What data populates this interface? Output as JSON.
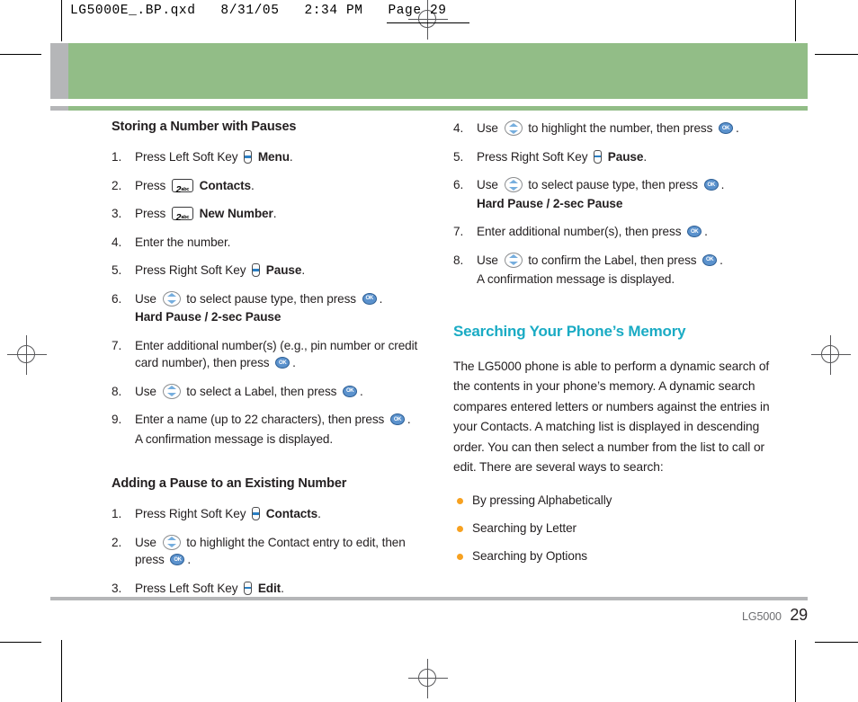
{
  "print_slug": {
    "text": "LG5000E_.BP.qxd   8/31/05   2:34 PM   Page 29"
  },
  "left_column": {
    "section_1": {
      "heading": "Storing a Number with Pauses",
      "steps": [
        {
          "num": "1.",
          "parts": [
            {
              "t": "text",
              "v": "Press Left Soft Key "
            },
            {
              "t": "icon",
              "v": "soft-key-icon"
            },
            {
              "t": "bold",
              "v": " Menu"
            },
            {
              "t": "text",
              "v": "."
            }
          ]
        },
        {
          "num": "2.",
          "parts": [
            {
              "t": "text",
              "v": "Press "
            },
            {
              "t": "numkey",
              "v": "2",
              "sub": "abc"
            },
            {
              "t": "bold",
              "v": " Contacts"
            },
            {
              "t": "text",
              "v": "."
            }
          ]
        },
        {
          "num": "3.",
          "parts": [
            {
              "t": "text",
              "v": "Press "
            },
            {
              "t": "numkey",
              "v": "2",
              "sub": "abc"
            },
            {
              "t": "bold",
              "v": " New Number"
            },
            {
              "t": "text",
              "v": "."
            }
          ]
        },
        {
          "num": "4.",
          "parts": [
            {
              "t": "text",
              "v": "Enter the number."
            }
          ]
        },
        {
          "num": "5.",
          "parts": [
            {
              "t": "text",
              "v": "Press Right Soft Key "
            },
            {
              "t": "icon",
              "v": "soft-key-icon"
            },
            {
              "t": "bold",
              "v": " Pause"
            },
            {
              "t": "text",
              "v": "."
            }
          ]
        },
        {
          "num": "6.",
          "parts": [
            {
              "t": "text",
              "v": "Use "
            },
            {
              "t": "icon",
              "v": "nav-updown-icon"
            },
            {
              "t": "text",
              "v": " to select pause type, then press "
            },
            {
              "t": "icon",
              "v": "ok-key-icon"
            },
            {
              "t": "text",
              "v": "."
            }
          ],
          "sub_bold": "Hard Pause / 2-sec Pause"
        },
        {
          "num": "7.",
          "parts": [
            {
              "t": "text",
              "v": "Enter additional number(s) (e.g., pin number or credit card number), then press "
            },
            {
              "t": "icon",
              "v": "ok-key-icon"
            },
            {
              "t": "text",
              "v": "."
            }
          ]
        },
        {
          "num": "8.",
          "parts": [
            {
              "t": "text",
              "v": "Use "
            },
            {
              "t": "icon",
              "v": "nav-updown-icon"
            },
            {
              "t": "text",
              "v": " to select a Label, then press "
            },
            {
              "t": "icon",
              "v": "ok-key-icon"
            },
            {
              "t": "text",
              "v": "."
            }
          ]
        },
        {
          "num": "9.",
          "parts": [
            {
              "t": "text",
              "v": "Enter a name (up to 22 characters), then press "
            },
            {
              "t": "icon",
              "v": "ok-key-icon"
            },
            {
              "t": "text",
              "v": "."
            }
          ],
          "sub_plain": "A confirmation message is displayed."
        }
      ]
    },
    "section_2": {
      "heading": "Adding a Pause to an Existing Number",
      "steps": [
        {
          "num": "1.",
          "parts": [
            {
              "t": "text",
              "v": "Press Right Soft Key "
            },
            {
              "t": "icon",
              "v": "soft-key-icon"
            },
            {
              "t": "bold",
              "v": " Contacts"
            },
            {
              "t": "text",
              "v": "."
            }
          ]
        },
        {
          "num": "2.",
          "parts": [
            {
              "t": "text",
              "v": "Use "
            },
            {
              "t": "icon",
              "v": "nav-updown-icon"
            },
            {
              "t": "text",
              "v": " to highlight the Contact entry to edit, then press "
            },
            {
              "t": "icon",
              "v": "ok-key-icon"
            },
            {
              "t": "text",
              "v": "."
            }
          ]
        },
        {
          "num": "3.",
          "parts": [
            {
              "t": "text",
              "v": "Press Left Soft Key "
            },
            {
              "t": "icon",
              "v": "soft-key-icon"
            },
            {
              "t": "bold",
              "v": " Edit"
            },
            {
              "t": "text",
              "v": "."
            }
          ]
        }
      ]
    }
  },
  "right_column": {
    "continued_steps": [
      {
        "num": "4.",
        "parts": [
          {
            "t": "text",
            "v": "Use "
          },
          {
            "t": "icon",
            "v": "nav-updown-icon"
          },
          {
            "t": "text",
            "v": " to highlight the number, then press "
          },
          {
            "t": "icon",
            "v": "ok-key-icon"
          },
          {
            "t": "text",
            "v": "."
          }
        ]
      },
      {
        "num": "5.",
        "parts": [
          {
            "t": "text",
            "v": "Press Right Soft Key "
          },
          {
            "t": "icon",
            "v": "soft-key-icon"
          },
          {
            "t": "bold",
            "v": " Pause"
          },
          {
            "t": "text",
            "v": "."
          }
        ]
      },
      {
        "num": "6.",
        "parts": [
          {
            "t": "text",
            "v": "Use "
          },
          {
            "t": "icon",
            "v": "nav-updown-icon"
          },
          {
            "t": "text",
            "v": " to select pause type, then press "
          },
          {
            "t": "icon",
            "v": "ok-key-icon"
          },
          {
            "t": "text",
            "v": "."
          }
        ],
        "sub_bold": "Hard Pause / 2-sec Pause"
      },
      {
        "num": "7.",
        "parts": [
          {
            "t": "text",
            "v": "Enter additional number(s), then press "
          },
          {
            "t": "icon",
            "v": "ok-key-icon"
          },
          {
            "t": "text",
            "v": "."
          }
        ]
      },
      {
        "num": "8.",
        "parts": [
          {
            "t": "text",
            "v": "Use "
          },
          {
            "t": "icon",
            "v": "nav-updown-icon"
          },
          {
            "t": "text",
            "v": " to confirm the Label, then press "
          },
          {
            "t": "icon",
            "v": "ok-key-icon"
          },
          {
            "t": "text",
            "v": "."
          }
        ],
        "sub_plain": "A confirmation message is displayed."
      }
    ],
    "section": {
      "heading": "Searching Your Phone’s Memory",
      "paragraph": "The LG5000 phone is able to perform a dynamic search of the contents in your phone’s memory. A dynamic search compares entered letters or numbers against the entries in your Contacts. A matching list is displayed in descending order. You can then select a number from the list to call or edit. There are several ways to search:",
      "bullets": [
        "By pressing Alphabetically",
        "Searching by Letter",
        "Searching by Options"
      ]
    }
  },
  "footer": {
    "brand": "LG5000",
    "page_number": "29"
  },
  "colors": {
    "banner_green": "#92bd87",
    "banner_tab_gray": "#b5b6b8",
    "heading_teal": "#1aabc4",
    "bullet_orange": "#f7a120",
    "key_blue": "#5b92cd",
    "nav_arrow_blue": "#76aede",
    "body_text": "#231f20",
    "footer_brand_gray": "#6d6e71"
  }
}
